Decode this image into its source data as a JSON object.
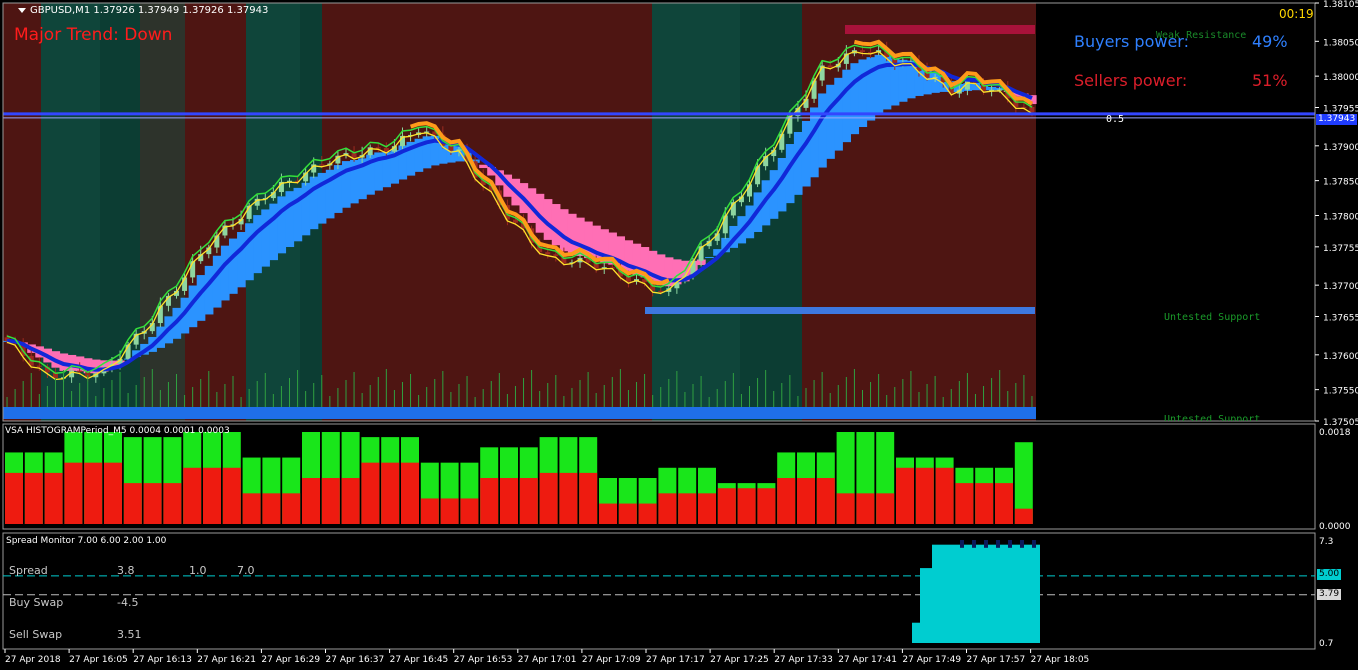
{
  "header": {
    "symbol_label": "GBPUSD,M1  1.37926 1.37949 1.37926 1.37943",
    "trend_text": "Major Trend: Down",
    "clock": "00:19"
  },
  "power": {
    "buyers_label": "Buyers power:",
    "buyers_value": "49%",
    "sellers_label": "Sellers power:",
    "sellers_value": "51%"
  },
  "levels": {
    "weak_resistance": "Weak Resistance",
    "untested_support": "Untested Support",
    "untested_support_2": "Untested Support",
    "fib_label": "0.5",
    "current_price_tag": "1.37943"
  },
  "colors": {
    "bg": "#000000",
    "bull_zone": "#0c3d33",
    "bear_zone": "#4e1512",
    "bull_candle": "#8ed6a0",
    "bear_candle": "#9c2a20",
    "cloud_up": "#2b93ff",
    "cloud_down": "#ff6fb5",
    "ma_blue": "#1128d8",
    "ma_green": "#34e03a",
    "ma_yellow": "#ffe22a",
    "ma_orange": "#ff9a1a",
    "hist_green": "#19e61a",
    "hist_red": "#ee1b10",
    "spread_fill": "#00cdd0",
    "spread_dark": "#0a1a5c"
  },
  "chart_data": [
    {
      "type": "candlestick",
      "title": "GBPUSD,M1",
      "ohlc_header": [
        "1.37926",
        "1.37949",
        "1.37926",
        "1.37943"
      ],
      "y_ticks": [
        "1.38105",
        "1.38050",
        "1.38000",
        "1.37955",
        "1.37900",
        "1.37850",
        "1.37800",
        "1.37755",
        "1.37700",
        "1.37655",
        "1.37600",
        "1.37550",
        "1.37505"
      ],
      "ylim": [
        1.37505,
        1.38105
      ],
      "x_ticks": [
        "27 Apr 2018",
        "27 Apr 16:05",
        "27 Apr 16:13",
        "27 Apr 16:21",
        "27 Apr 16:29",
        "27 Apr 16:37",
        "27 Apr 16:45",
        "27 Apr 16:53",
        "27 Apr 17:01",
        "27 Apr 17:09",
        "27 Apr 17:17",
        "27 Apr 17:25",
        "27 Apr 17:33",
        "27 Apr 17:41",
        "27 Apr 17:49",
        "27 Apr 17:57",
        "27 Apr 18:05"
      ],
      "close_anchors": [
        [
          0,
          1.3762
        ],
        [
          5,
          1.3757
        ],
        [
          12,
          1.37575
        ],
        [
          18,
          1.3765
        ],
        [
          25,
          1.3776
        ],
        [
          32,
          1.3783
        ],
        [
          40,
          1.3788
        ],
        [
          48,
          1.379
        ],
        [
          51,
          1.37925
        ],
        [
          56,
          1.3789
        ],
        [
          62,
          1.378
        ],
        [
          67,
          1.3774
        ],
        [
          73,
          1.3773
        ],
        [
          79,
          1.377
        ],
        [
          82,
          1.3769
        ],
        [
          88,
          1.3778
        ],
        [
          95,
          1.379
        ],
        [
          101,
          1.3801
        ],
        [
          106,
          1.3804
        ],
        [
          113,
          1.3801
        ],
        [
          117,
          1.3798
        ],
        [
          120,
          1.3799
        ],
        [
          124,
          1.3797
        ],
        [
          128,
          1.37935
        ]
      ],
      "current_price": 1.37943,
      "fib_level": 0.5
    },
    {
      "type": "bar",
      "title": "VSA HISTOGRAMPeriod_M5 0.0004 0.0001 0.0003",
      "y_ticks": [
        "0.0018",
        "0.0000"
      ],
      "series": [
        {
          "name": "green",
          "values": [
            0.0014,
            0.0018,
            0.0017,
            0.0018,
            0.0013,
            0.0018,
            0.0017,
            0.0012,
            0.0015,
            0.0017,
            0.0009,
            0.0011,
            0.0008,
            0.0014,
            0.0018,
            0.0013,
            0.0011,
            0.0016
          ]
        },
        {
          "name": "red",
          "values": [
            0.001,
            0.0012,
            0.0008,
            0.0011,
            0.0006,
            0.0009,
            0.0012,
            0.0005,
            0.0009,
            0.001,
            0.0004,
            0.0006,
            0.0007,
            0.0009,
            0.0006,
            0.0011,
            0.0008,
            0.0003
          ]
        }
      ]
    },
    {
      "type": "area",
      "title": "Spread Monitor 7.00 6.00 2.00 1.00",
      "y_ticks": [
        "7.3",
        "5.00",
        "3.79",
        "0.7"
      ],
      "levels": [
        5.0,
        3.79
      ],
      "rows": [
        {
          "label": "Spread",
          "values": [
            "3.8",
            "1.0",
            "7.0"
          ]
        },
        {
          "label": "Buy Swap",
          "values": [
            "-4.5"
          ]
        },
        {
          "label": "Sell Swap",
          "values": [
            "3.51"
          ]
        }
      ]
    }
  ]
}
